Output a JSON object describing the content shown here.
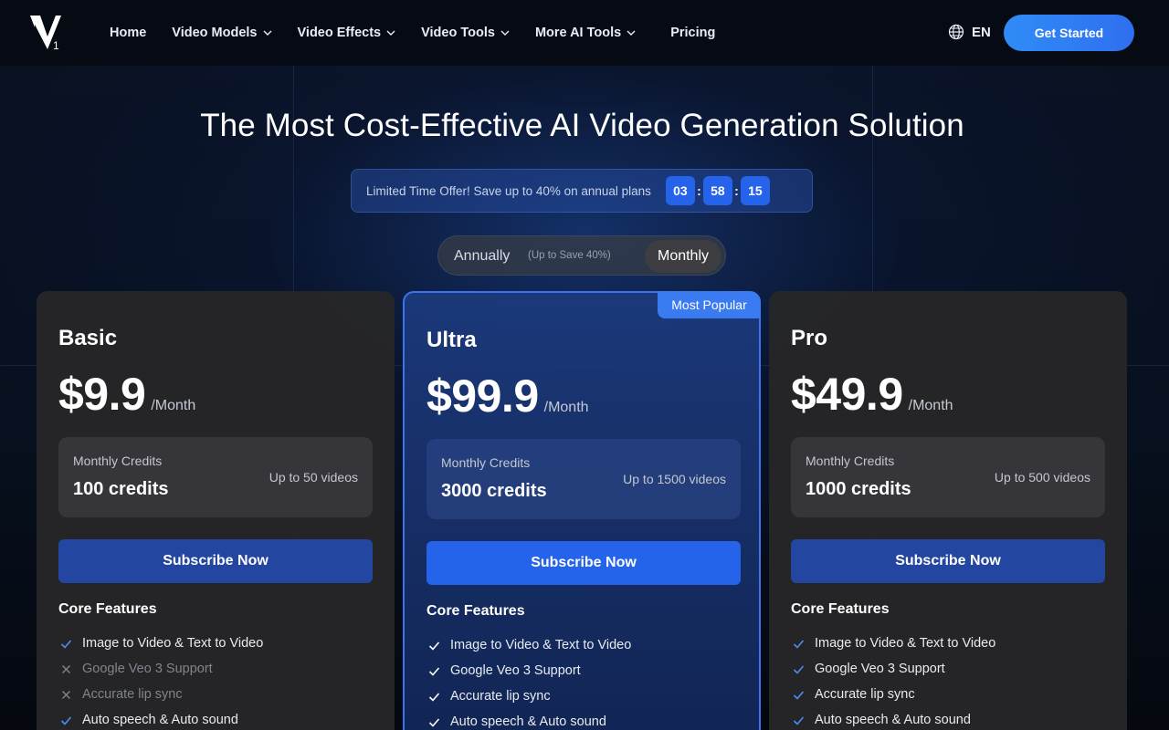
{
  "header": {
    "logo_text": "1",
    "nav": [
      {
        "label": "Home",
        "dropdown": false
      },
      {
        "label": "Video Models",
        "dropdown": true
      },
      {
        "label": "Video Effects",
        "dropdown": true
      },
      {
        "label": "Video Tools",
        "dropdown": true
      },
      {
        "label": "More AI Tools",
        "dropdown": true
      },
      {
        "label": "Pricing",
        "dropdown": false
      }
    ],
    "language": "EN",
    "cta_label": "Get Started"
  },
  "hero": {
    "title": "The Most Cost-Effective AI Video Generation Solution",
    "offer_text": "Limited Time Offer! Save up to 40% on annual plans",
    "countdown": {
      "hours": "03",
      "minutes": "58",
      "seconds": "15"
    }
  },
  "billing_toggle": {
    "annual_label": "Annually",
    "annual_note": "(Up to Save 40%)",
    "monthly_label": "Monthly",
    "selected": "Monthly"
  },
  "plans": {
    "basic": {
      "name": "Basic",
      "price": "$9.9",
      "unit": "/Month",
      "credits_label": "Monthly Credits",
      "credits_value": "100 credits",
      "videos": "Up to 50 videos",
      "subscribe_label": "Subscribe Now",
      "core_features_title": "Core Features",
      "features": [
        {
          "label": "Image to Video & Text to Video",
          "included": true
        },
        {
          "label": "Google Veo 3 Support",
          "included": false
        },
        {
          "label": "Accurate lip sync",
          "included": false
        },
        {
          "label": "Auto speech & Auto sound",
          "included": true
        }
      ]
    },
    "ultra": {
      "name": "Ultra",
      "badge": "Most Popular",
      "price": "$99.9",
      "unit": "/Month",
      "credits_label": "Monthly Credits",
      "credits_value": "3000 credits",
      "videos": "Up to 1500 videos",
      "subscribe_label": "Subscribe Now",
      "core_features_title": "Core Features",
      "features": [
        {
          "label": "Image to Video & Text to Video",
          "included": true
        },
        {
          "label": "Google Veo 3 Support",
          "included": true
        },
        {
          "label": "Accurate lip sync",
          "included": true
        },
        {
          "label": "Auto speech & Auto sound",
          "included": true
        }
      ]
    },
    "pro": {
      "name": "Pro",
      "price": "$49.9",
      "unit": "/Month",
      "credits_label": "Monthly Credits",
      "credits_value": "1000 credits",
      "videos": "Up to 500 videos",
      "subscribe_label": "Subscribe Now",
      "core_features_title": "Core Features",
      "features": [
        {
          "label": "Image to Video & Text to Video",
          "included": true
        },
        {
          "label": "Google Veo 3 Support",
          "included": true
        },
        {
          "label": "Accurate lip sync",
          "included": true
        },
        {
          "label": "Auto speech & Auto sound",
          "included": true
        }
      ]
    }
  },
  "colors": {
    "accent": "#2563eb",
    "check": "#4d8cf5",
    "cross": "#7f848d"
  }
}
